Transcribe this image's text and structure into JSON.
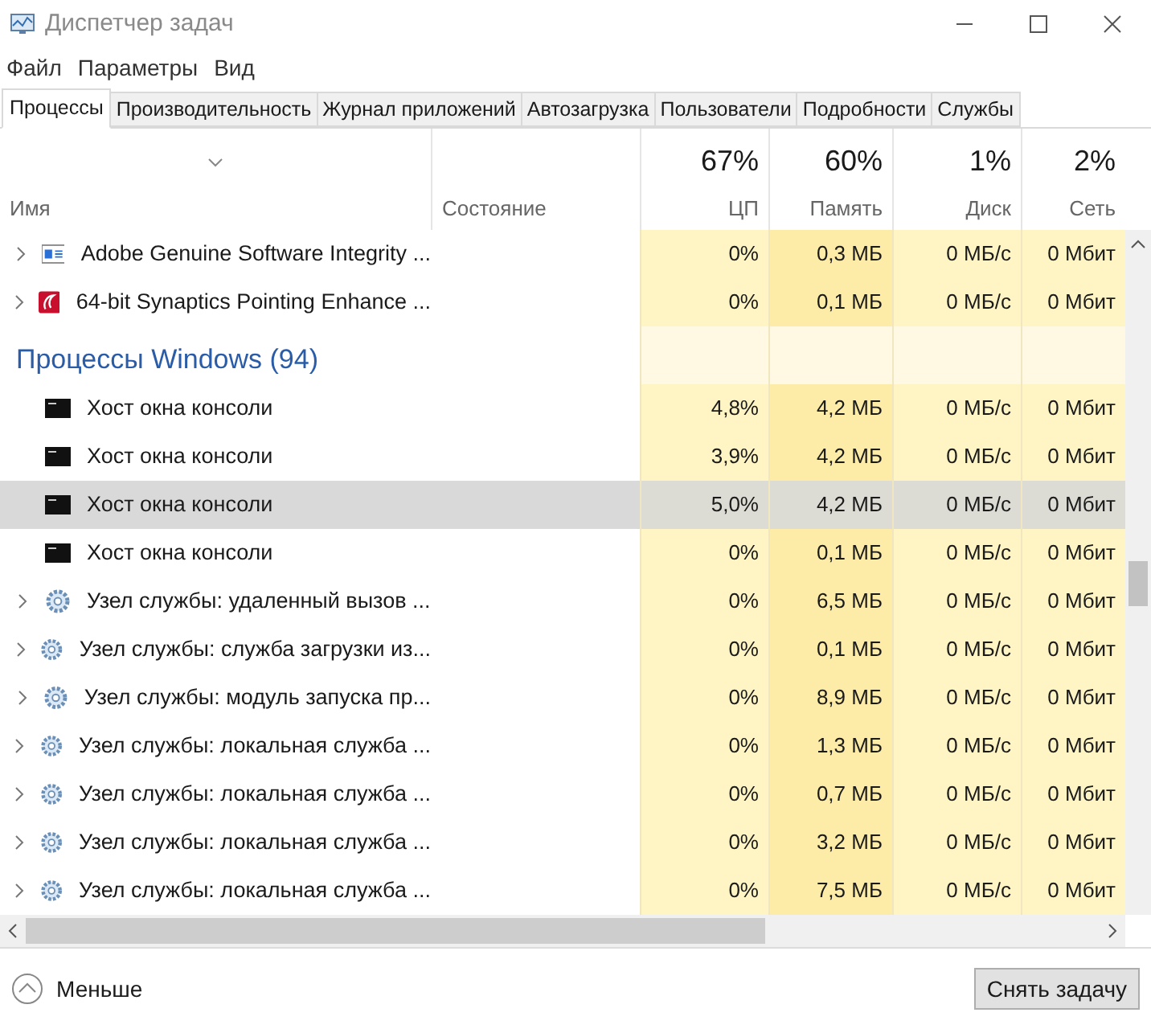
{
  "window": {
    "title": "Диспетчер задач"
  },
  "menu": [
    "Файл",
    "Параметры",
    "Вид"
  ],
  "tabs": [
    {
      "label": "Процессы",
      "selected": true
    },
    {
      "label": "Производительность",
      "selected": false
    },
    {
      "label": "Журнал приложений",
      "selected": false
    },
    {
      "label": "Автозагрузка",
      "selected": false
    },
    {
      "label": "Пользователи",
      "selected": false
    },
    {
      "label": "Подробности",
      "selected": false
    },
    {
      "label": "Службы",
      "selected": false
    }
  ],
  "columns": [
    {
      "label": "Имя"
    },
    {
      "label": "Состояние"
    },
    {
      "label": "ЦП",
      "usage": "67%"
    },
    {
      "label": "Память",
      "usage": "60%"
    },
    {
      "label": "Диск",
      "usage": "1%"
    },
    {
      "label": "Сеть",
      "usage": "2%"
    }
  ],
  "rows": [
    {
      "kind": "adobe",
      "expandable": true,
      "selected": false,
      "name": "Adobe Genuine Software Integrity ...",
      "cpu": "0%",
      "memory": "0,3 МБ",
      "disk": "0 МБ/с",
      "network": "0 Мбит"
    },
    {
      "kind": "synaptics",
      "expandable": true,
      "selected": false,
      "name": "64-bit Synaptics Pointing Enhance ...",
      "cpu": "0%",
      "memory": "0,1 МБ",
      "disk": "0 МБ/с",
      "network": "0 Мбит"
    },
    {
      "kind": "group",
      "name": "Процессы Windows (94)"
    },
    {
      "kind": "console",
      "expandable": false,
      "selected": false,
      "name": "Хост окна консоли",
      "cpu": "4,8%",
      "memory": "4,2 МБ",
      "disk": "0 МБ/с",
      "network": "0 Мбит"
    },
    {
      "kind": "console",
      "expandable": false,
      "selected": false,
      "name": "Хост окна консоли",
      "cpu": "3,9%",
      "memory": "4,2 МБ",
      "disk": "0 МБ/с",
      "network": "0 Мбит"
    },
    {
      "kind": "console",
      "expandable": false,
      "selected": true,
      "name": "Хост окна консоли",
      "cpu": "5,0%",
      "memory": "4,2 МБ",
      "disk": "0 МБ/с",
      "network": "0 Мбит"
    },
    {
      "kind": "console",
      "expandable": false,
      "selected": false,
      "name": "Хост окна консоли",
      "cpu": "0%",
      "memory": "0,1 МБ",
      "disk": "0 МБ/с",
      "network": "0 Мбит"
    },
    {
      "kind": "service",
      "expandable": true,
      "selected": false,
      "name": "Узел службы: удаленный вызов ...",
      "cpu": "0%",
      "memory": "6,5 МБ",
      "disk": "0 МБ/с",
      "network": "0 Мбит"
    },
    {
      "kind": "service",
      "expandable": true,
      "selected": false,
      "name": "Узел службы: служба загрузки из...",
      "cpu": "0%",
      "memory": "0,1 МБ",
      "disk": "0 МБ/с",
      "network": "0 Мбит"
    },
    {
      "kind": "service",
      "expandable": true,
      "selected": false,
      "name": "Узел службы: модуль запуска пр...",
      "cpu": "0%",
      "memory": "8,9 МБ",
      "disk": "0 МБ/с",
      "network": "0 Мбит"
    },
    {
      "kind": "service",
      "expandable": true,
      "selected": false,
      "name": "Узел службы: локальная служба ...",
      "cpu": "0%",
      "memory": "1,3 МБ",
      "disk": "0 МБ/с",
      "network": "0 Мбит"
    },
    {
      "kind": "service",
      "expandable": true,
      "selected": false,
      "name": "Узел службы: локальная служба ...",
      "cpu": "0%",
      "memory": "0,7 МБ",
      "disk": "0 МБ/с",
      "network": "0 Мбит"
    },
    {
      "kind": "service",
      "expandable": true,
      "selected": false,
      "name": "Узел службы: локальная служба ...",
      "cpu": "0%",
      "memory": "3,2 МБ",
      "disk": "0 МБ/с",
      "network": "0 Мбит"
    },
    {
      "kind": "service",
      "expandable": true,
      "selected": false,
      "name": "Узел службы: локальная служба ...",
      "cpu": "0%",
      "memory": "7,5 МБ",
      "disk": "0 МБ/с",
      "network": "0 Мбит"
    }
  ],
  "footer": {
    "toggle": "Меньше",
    "end_task_button": "Снять задачу"
  }
}
